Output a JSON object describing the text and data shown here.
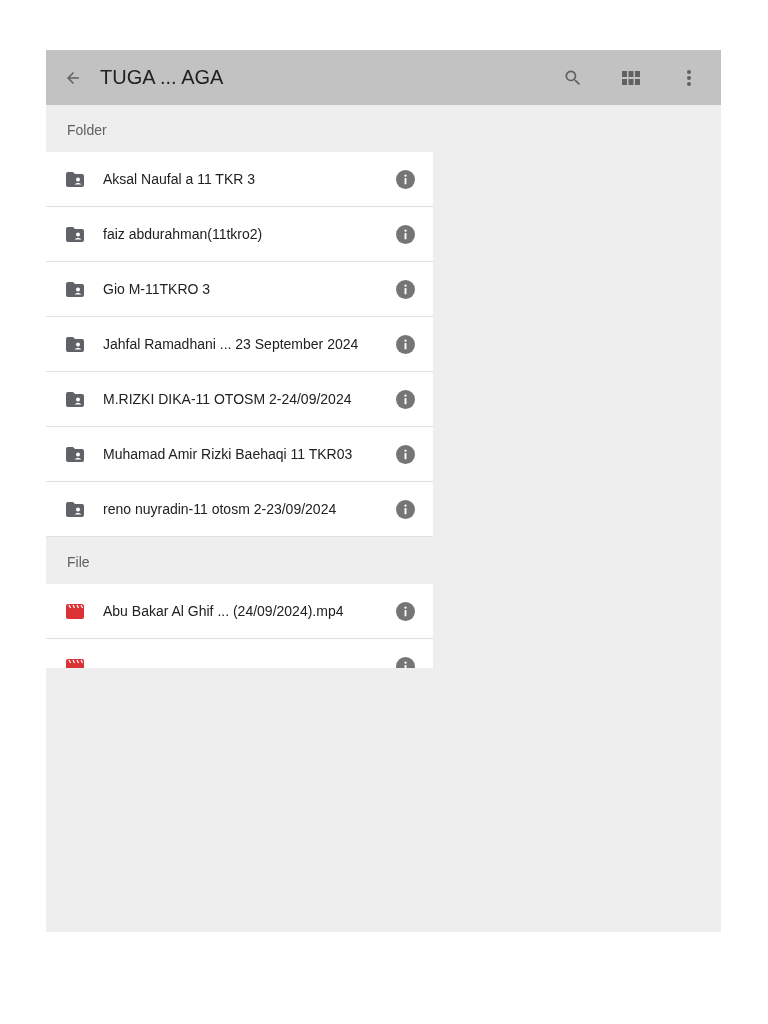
{
  "app_bar": {
    "title": "TUGA ... AGA"
  },
  "sections": [
    {
      "heading": "Folder",
      "items": [
        {
          "kind": "folder",
          "name": "Aksal Naufal a 11 TKR 3"
        },
        {
          "kind": "folder",
          "name": "faiz abdurahman(11tkro2)"
        },
        {
          "kind": "folder",
          "name": "Gio M-11TKRO 3"
        },
        {
          "kind": "folder",
          "name": "Jahfal Ramadhani ... 23 September 2024"
        },
        {
          "kind": "folder",
          "name": "M.RIZKI DIKA-11 OTOSM 2-24/09/2024"
        },
        {
          "kind": "folder",
          "name": "Muhamad Amir Rizki Baehaqi 11 TKR03"
        },
        {
          "kind": "folder",
          "name": "reno nuyradin-11 otosm 2-23/09/2024"
        }
      ]
    },
    {
      "heading": "File",
      "items": [
        {
          "kind": "video",
          "name": "Abu Bakar Al Ghif ... (24/09/2024).mp4"
        },
        {
          "kind": "video"
        }
      ]
    }
  ]
}
